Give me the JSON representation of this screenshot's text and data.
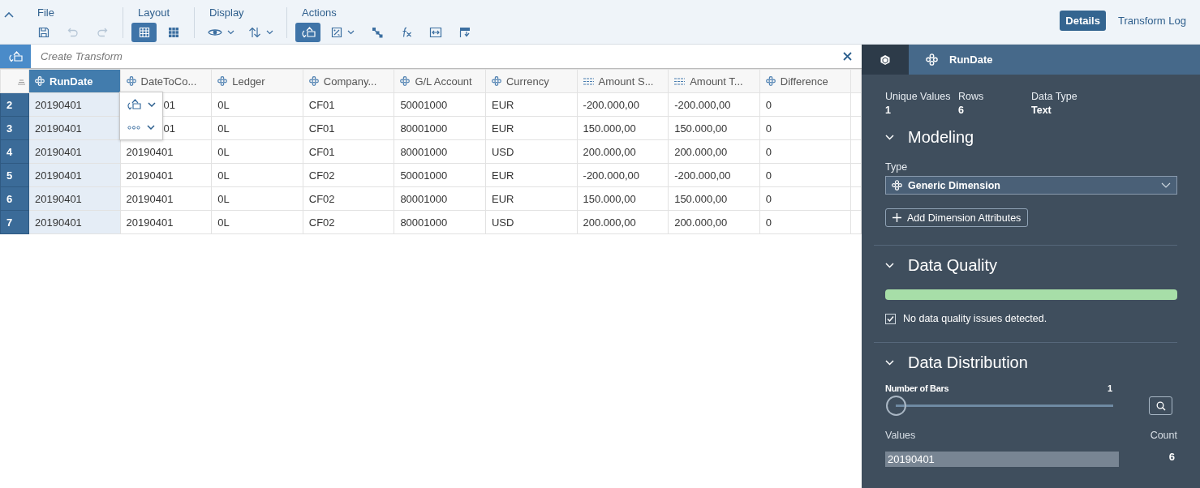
{
  "toolbar": {
    "groups": [
      {
        "label": "File",
        "tools": [
          {
            "kind": "save",
            "selected": false,
            "disabled": false,
            "menu": false
          },
          {
            "kind": "undo",
            "selected": false,
            "disabled": true,
            "menu": false
          },
          {
            "kind": "redo",
            "selected": false,
            "disabled": true,
            "menu": false
          }
        ]
      },
      {
        "label": "Layout",
        "tools": [
          {
            "kind": "table",
            "selected": true,
            "disabled": false,
            "menu": false
          },
          {
            "kind": "grid",
            "selected": false,
            "disabled": false,
            "menu": false
          }
        ]
      },
      {
        "label": "Display",
        "tools": [
          {
            "kind": "eye",
            "selected": false,
            "disabled": false,
            "menu": true
          },
          {
            "kind": "sort",
            "selected": false,
            "disabled": false,
            "menu": true
          }
        ]
      },
      {
        "label": "Actions",
        "tools": [
          {
            "kind": "transform",
            "selected": true,
            "disabled": false,
            "menu": false
          },
          {
            "kind": "image",
            "selected": false,
            "disabled": false,
            "menu": true
          },
          {
            "kind": "hierarchy",
            "selected": false,
            "disabled": false,
            "menu": false
          },
          {
            "kind": "fx",
            "selected": false,
            "disabled": false,
            "menu": false
          },
          {
            "kind": "fit",
            "selected": false,
            "disabled": false,
            "menu": false
          },
          {
            "kind": "layout",
            "selected": false,
            "disabled": false,
            "menu": false
          }
        ]
      }
    ],
    "view_tabs": [
      {
        "label": "Details",
        "selected": true
      },
      {
        "label": "Transform Log",
        "selected": false
      }
    ]
  },
  "transform_bar": {
    "placeholder": "Create Transform"
  },
  "table": {
    "columns": [
      {
        "label": "RunDate",
        "kind": "dimension",
        "selected": true
      },
      {
        "label": "DateToCo...",
        "kind": "dimension",
        "selected": false
      },
      {
        "label": "Ledger",
        "kind": "dimension",
        "selected": false
      },
      {
        "label": "Company...",
        "kind": "dimension",
        "selected": false
      },
      {
        "label": "G/L Account",
        "kind": "dimension",
        "selected": false
      },
      {
        "label": "Currency",
        "kind": "dimension",
        "selected": false
      },
      {
        "label": "Amount S...",
        "kind": "measure",
        "selected": false
      },
      {
        "label": "Amount T...",
        "kind": "measure",
        "selected": false
      },
      {
        "label": "Difference",
        "kind": "dimension",
        "selected": false
      }
    ],
    "rows": [
      {
        "number": "2",
        "under_menu": true,
        "cells": [
          "20190401",
          "01",
          "0L",
          "CF01",
          "50001000",
          "EUR",
          "-200.000,00",
          "-200.000,00",
          "0"
        ]
      },
      {
        "number": "3",
        "under_menu": true,
        "cells": [
          "20190401",
          "01",
          "0L",
          "CF01",
          "80001000",
          "EUR",
          "150.000,00",
          "150.000,00",
          "0"
        ]
      },
      {
        "number": "4",
        "under_menu": false,
        "cells": [
          "20190401",
          "20190401",
          "0L",
          "CF01",
          "80001000",
          "USD",
          "200.000,00",
          "200.000,00",
          "0"
        ]
      },
      {
        "number": "5",
        "under_menu": false,
        "cells": [
          "20190401",
          "20190401",
          "0L",
          "CF02",
          "50001000",
          "EUR",
          "-200.000,00",
          "-200.000,00",
          "0"
        ]
      },
      {
        "number": "6",
        "under_menu": false,
        "cells": [
          "20190401",
          "20190401",
          "0L",
          "CF02",
          "80001000",
          "EUR",
          "150.000,00",
          "150.000,00",
          "0"
        ]
      },
      {
        "number": "7",
        "under_menu": false,
        "cells": [
          "20190401",
          "20190401",
          "0L",
          "CF02",
          "80001000",
          "USD",
          "200.000,00",
          "200.000,00",
          "0"
        ]
      }
    ],
    "menu": [
      {
        "kind": "transform"
      },
      {
        "kind": "more"
      }
    ]
  },
  "panel": {
    "column": "RunDate",
    "stats": [
      {
        "label": "Unique Values",
        "value": "1"
      },
      {
        "label": "Rows",
        "value": "6"
      },
      {
        "label": "Data Type",
        "value": "Text"
      }
    ],
    "modeling": {
      "title": "Modeling",
      "expanded": true,
      "type_label": "Type",
      "type_value": "Generic Dimension",
      "add_button": "Add Dimension Attributes"
    },
    "quality": {
      "title": "Data Quality",
      "expanded": true,
      "checked": true,
      "message": "No data quality issues detected."
    },
    "distribution": {
      "title": "Data Distribution",
      "expanded": true,
      "bars_label": "Number of Bars",
      "bars_value": "1",
      "level": 0,
      "values_label": "Values",
      "count_label": "Count",
      "values": [
        {
          "value": "20190401",
          "count": "6"
        }
      ]
    }
  }
}
